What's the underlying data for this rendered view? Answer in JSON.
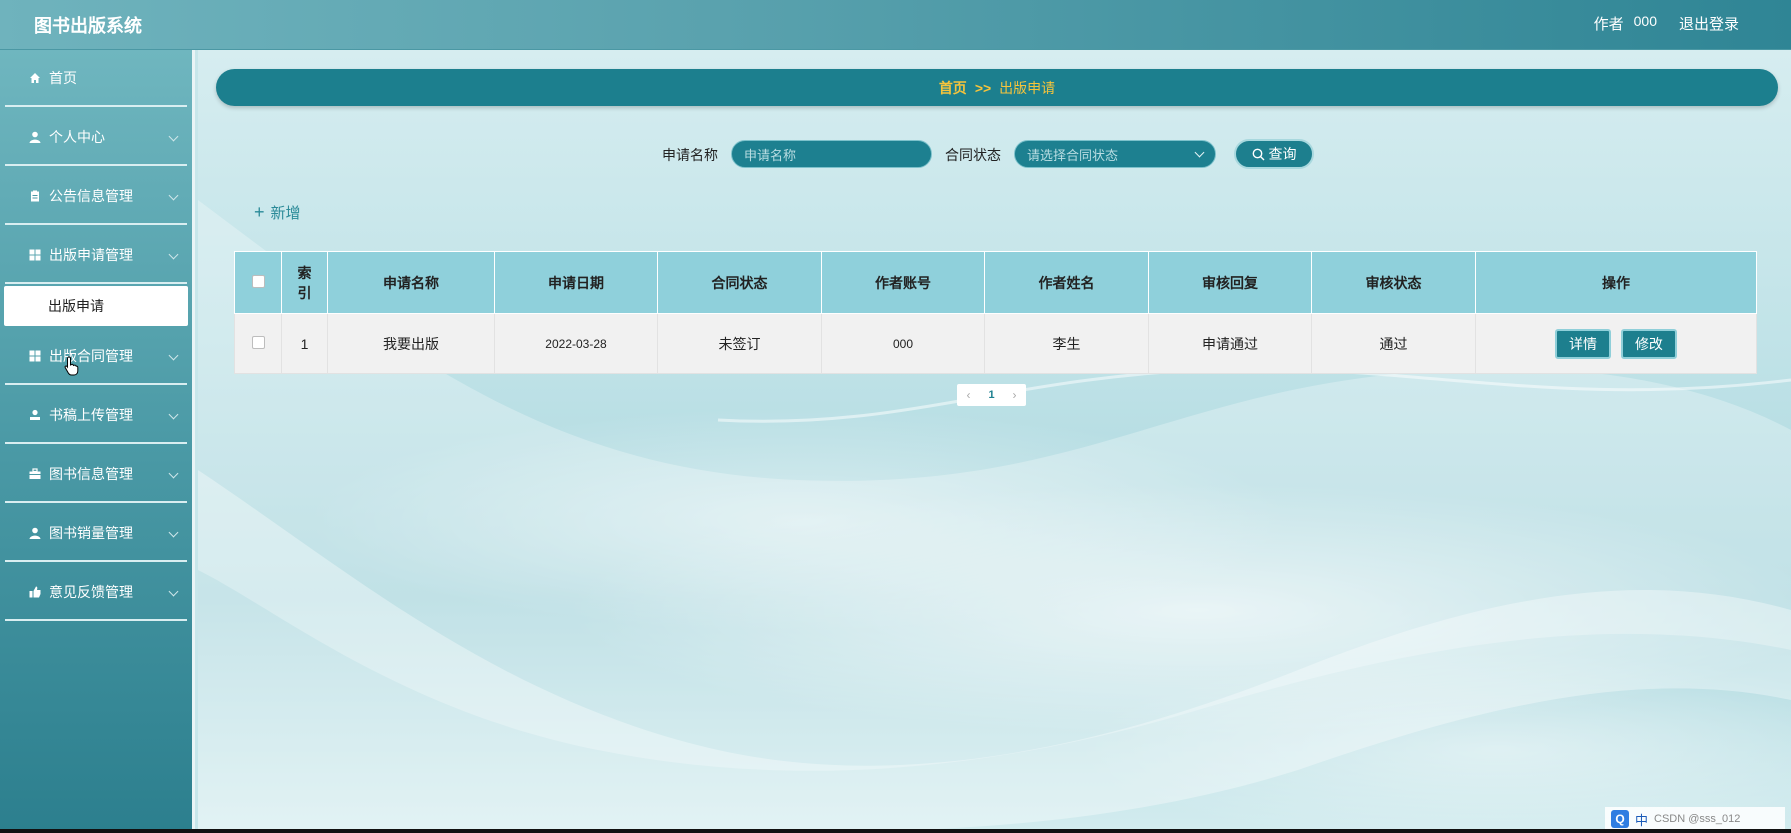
{
  "app": {
    "title": "图书出版系统"
  },
  "header": {
    "role": "作者",
    "user_id": "000",
    "logout": "退出登录"
  },
  "sidebar": {
    "items": [
      {
        "label": "首页",
        "icon": "home-icon"
      },
      {
        "label": "个人中心",
        "icon": "user-icon"
      },
      {
        "label": "公告信息管理",
        "icon": "clipboard-icon"
      },
      {
        "label": "出版申请管理",
        "icon": "grid-icon"
      },
      {
        "label": "出版合同管理",
        "icon": "grid-icon"
      },
      {
        "label": "书稿上传管理",
        "icon": "upload-user-icon"
      },
      {
        "label": "图书信息管理",
        "icon": "briefcase-icon"
      },
      {
        "label": "图书销量管理",
        "icon": "user-icon"
      },
      {
        "label": "意见反馈管理",
        "icon": "feedback-icon"
      }
    ],
    "sub_item": "出版申请"
  },
  "breadcrumb": {
    "home": "首页",
    "separator": ">>",
    "current": "出版申请"
  },
  "search": {
    "name_label": "申请名称",
    "name_placeholder": "申请名称",
    "status_label": "合同状态",
    "status_placeholder": "请选择合同状态",
    "query_label": "查询"
  },
  "toolbar": {
    "add_label": "新增"
  },
  "table": {
    "headers": [
      "索引",
      "申请名称",
      "申请日期",
      "合同状态",
      "作者账号",
      "作者姓名",
      "审核回复",
      "审核状态",
      "操作"
    ],
    "rows": [
      {
        "index": "1",
        "name": "我要出版",
        "date": "2022-03-28",
        "contract_status": "未签订",
        "account": "000",
        "author_name": "李生",
        "review_reply": "申请通过",
        "review_status": "通过",
        "detail": "详情",
        "edit": "修改"
      }
    ]
  },
  "pagination": {
    "current_page": "1"
  },
  "ime": {
    "lang": "中",
    "watermark": "CSDN @sss_012"
  },
  "colors": {
    "primary": "#1d7f8e",
    "accent": "#f5c43c",
    "header_bg": "#5aa2ae",
    "table_header": "#8fd0db"
  }
}
